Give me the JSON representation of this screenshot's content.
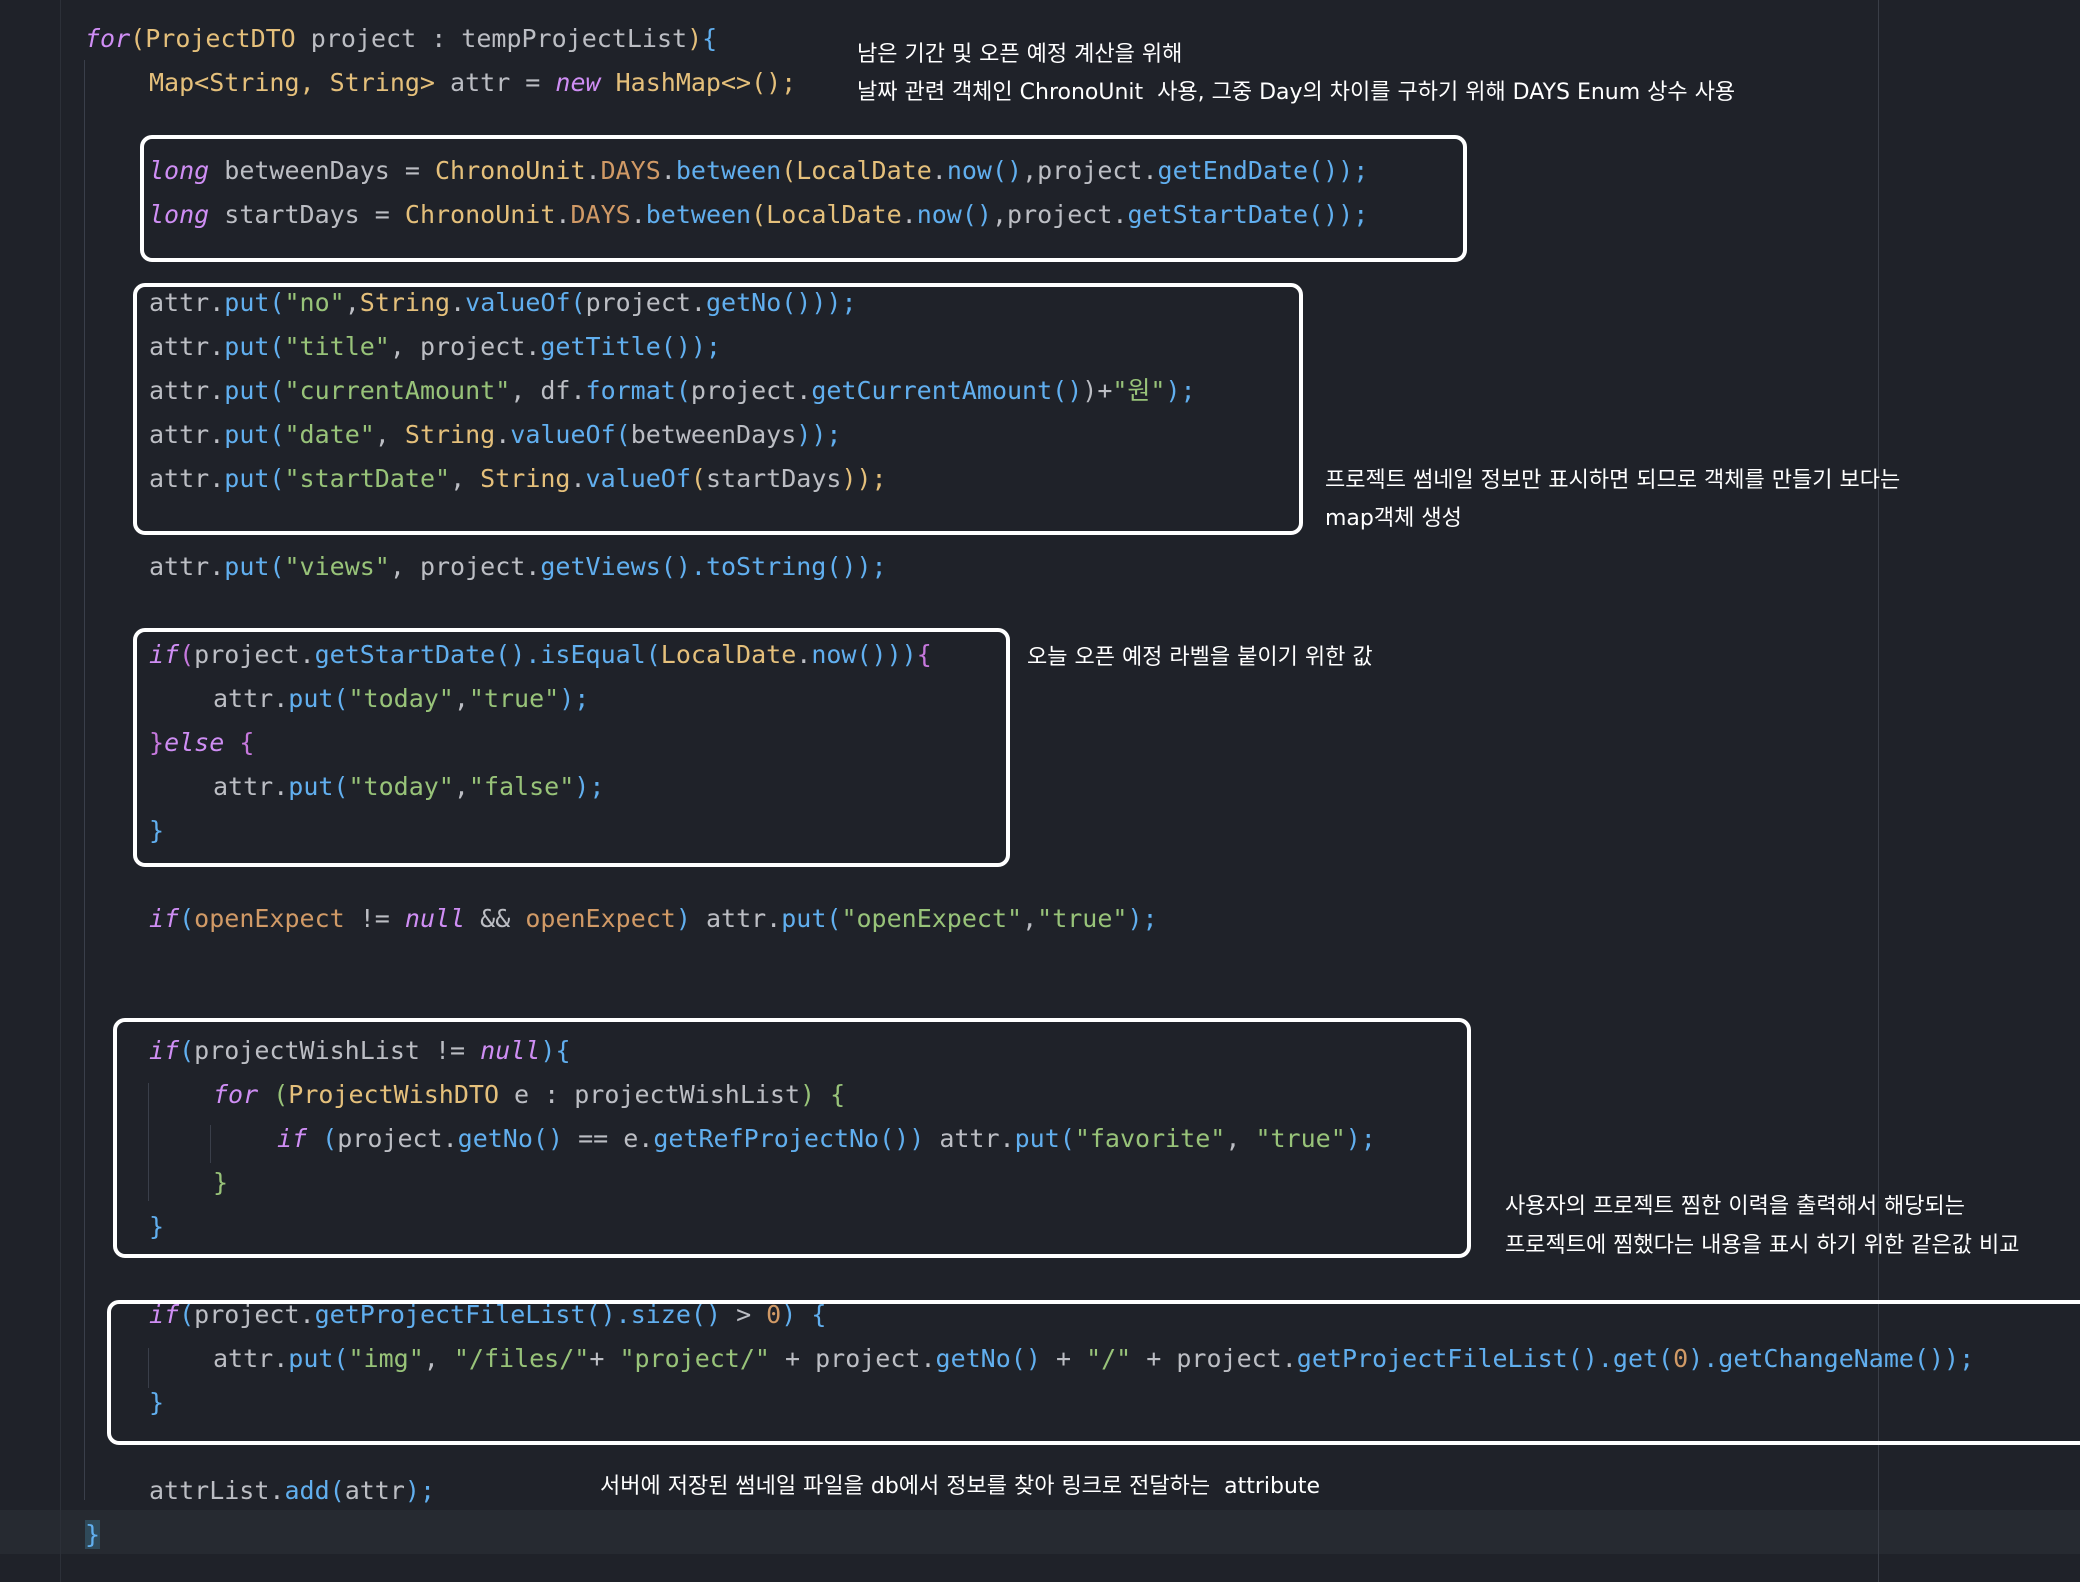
{
  "code": {
    "l1": {
      "kw_for": "for",
      "p1": "(",
      "t1": "ProjectDTO",
      "v1": " project : tempProjectList",
      "p2": ")",
      "b1": "{"
    },
    "l2": {
      "t1": "Map<String, String>",
      "v1": " attr = ",
      "kw": "new",
      "t2": " HashMap<>",
      "p": "();"
    },
    "l3": {
      "kw": "long",
      "v1": " betweenDays = ",
      "t1": "ChronoUnit",
      "d1": ".",
      "c1": "DAYS",
      "d2": ".",
      "f1": "between",
      "p1": "(",
      "t2": "LocalDate",
      "d3": ".",
      "f2": "now",
      "p2": "()",
      "v2": ",project.",
      "f3": "getEndDate",
      "p3": "());"
    },
    "l4": {
      "kw": "long",
      "v1": " startDays = ",
      "t1": "ChronoUnit",
      "d1": ".",
      "c1": "DAYS",
      "d2": ".",
      "f1": "between",
      "p1": "(",
      "t2": "LocalDate",
      "d3": ".",
      "f2": "now",
      "p2": "()",
      "v2": ",project.",
      "f3": "getStartDate",
      "p3": "());"
    },
    "l5": {
      "v1": "attr.",
      "f1": "put",
      "p1": "(",
      "s1": "\"no\"",
      "v2": ",",
      "t1": "String",
      "d1": ".",
      "f2": "valueOf",
      "p2": "(",
      "v3": "project.",
      "f3": "getNo",
      "p3": "()));"
    },
    "l6": {
      "v1": "attr.",
      "f1": "put",
      "p1": "(",
      "s1": "\"title\"",
      "v2": ", project.",
      "f2": "getTitle",
      "p2": "());"
    },
    "l7": {
      "v1": "attr.",
      "f1": "put",
      "p1": "(",
      "s1": "\"currentAmount\"",
      "v2": ", df.",
      "f2": "format",
      "p2": "(",
      "v3": "project.",
      "f3": "getCurrentAmount",
      "p3": "()",
      "v4": ")+",
      "s2": "\"원\"",
      "p4": ");"
    },
    "l8": {
      "v1": "attr.",
      "f1": "put",
      "p1": "(",
      "s1": "\"date\"",
      "v2": ", ",
      "t1": "String",
      "d1": ".",
      "f2": "valueOf",
      "p2": "(",
      "v3": "betweenDays",
      "p3": "));"
    },
    "l9": {
      "v1": "attr.",
      "f1": "put",
      "p1": "(",
      "s1": "\"startDate\"",
      "v2": ", ",
      "t1": "String",
      "d1": ".",
      "f2": "valueOf",
      "p2": "(",
      "v3": "startDays",
      "p3": "));"
    },
    "l10": {
      "v1": "attr.",
      "f1": "put",
      "p1": "(",
      "s1": "\"views\"",
      "v2": ", project.",
      "f2": "getViews",
      "p2": "().",
      "f3": "toString",
      "p3": "());"
    },
    "l11": {
      "kw": "if",
      "p1": "(",
      "v1": "project.",
      "f1": "getStartDate",
      "p2": "().",
      "f2": "isEqual",
      "p3": "(",
      "t1": "LocalDate",
      "d1": ".",
      "f3": "now",
      "p4": "()))",
      "b1": "{"
    },
    "l12": {
      "v1": "attr.",
      "f1": "put",
      "p1": "(",
      "s1": "\"today\"",
      "v2": ",",
      "s2": "\"true\"",
      "p2": ");"
    },
    "l13": {
      "b1": "}",
      "kw": "else",
      "b2": " {"
    },
    "l14": {
      "v1": "attr.",
      "f1": "put",
      "p1": "(",
      "s1": "\"today\"",
      "v2": ",",
      "s2": "\"false\"",
      "p2": ");"
    },
    "l15": {
      "b1": "}"
    },
    "l16": {
      "kw": "if",
      "p1": "(",
      "c1": "openExpect",
      "v1": " != ",
      "kw2": "null",
      "v2": " && ",
      "c2": "openExpect",
      "p2": ")",
      "v3": " attr.",
      "f1": "put",
      "p3": "(",
      "s1": "\"openExpect\"",
      "v4": ",",
      "s2": "\"true\"",
      "p4": ");"
    },
    "l17": {
      "kw": "if",
      "p1": "(",
      "v1": "projectWishList != ",
      "kw2": "null",
      "p2": ")",
      "b1": "{"
    },
    "l18": {
      "kw": "for",
      "v1": " ",
      "p1": "(",
      "t1": "ProjectWishDTO",
      "v2": " e : projectWishList",
      "p2": ")",
      "b1": " {"
    },
    "l19": {
      "kw": "if",
      "v1": " ",
      "p1": "(",
      "v2": "project.",
      "f1": "getNo",
      "p2": "()",
      "v3": " == e.",
      "f2": "getRefProjectNo",
      "p3": "())",
      "v4": " attr.",
      "f3": "put",
      "p4": "(",
      "s1": "\"favorite\"",
      "v5": ", ",
      "s2": "\"true\"",
      "p5": ");"
    },
    "l20": {
      "b1": "}"
    },
    "l21": {
      "b1": "}"
    },
    "l22": {
      "kw": "if",
      "p1": "(",
      "v1": "project.",
      "f1": "getProjectFileList",
      "p2": "().",
      "f2": "size",
      "p3": "()",
      "v2": " > ",
      "n1": "0",
      "p4": ")",
      "b1": " {"
    },
    "l23": {
      "v1": "attr.",
      "f1": "put",
      "p1": "(",
      "s1": "\"img\"",
      "v2": ", ",
      "s2": "\"/files/\"",
      "v3": "+ ",
      "s3": "\"project/\"",
      "v4": " + project.",
      "f2": "getNo",
      "p2": "()",
      "v5": " + ",
      "s4": "\"/\"",
      "v6": " + project.",
      "f3": "getProjectFileList",
      "p3": "().",
      "f4": "get",
      "p4": "(",
      "n1": "0",
      "p5": ").",
      "f5": "getChangeName",
      "p6": "());"
    },
    "l24": {
      "b1": "}"
    },
    "l25": {
      "v1": "attrList.",
      "f1": "add",
      "p1": "(",
      "v2": "attr",
      "p2": ");"
    },
    "l26": {
      "b1": "}"
    }
  },
  "annotations": {
    "a1_line1": "남은 기간 및 오픈 예정 계산을 위해",
    "a1_line2": "날짜 관련 객체인 ChronoUnit  사용, 그중 Day의 차이를 구하기 위해 DAYS Enum 상수 사용",
    "a2_line1": "프로젝트 썸네일 정보만 표시하면 되므로 객체를 만들기 보다는",
    "a2_line2": "map객체 생성",
    "a3": "오늘 오픈 예정 라벨을 붙이기 위한 값",
    "a4_line1": "사용자의 프로젝트 찜한 이력을 출력해서 해당되는",
    "a4_line2": "프로젝트에 찜했다는 내용을 표시 하기 위한 같은값 비교",
    "a5": "서버에 저장된 썸네일 파일을 db에서 정보를 찾아 링크로 전달하는  attribute"
  }
}
